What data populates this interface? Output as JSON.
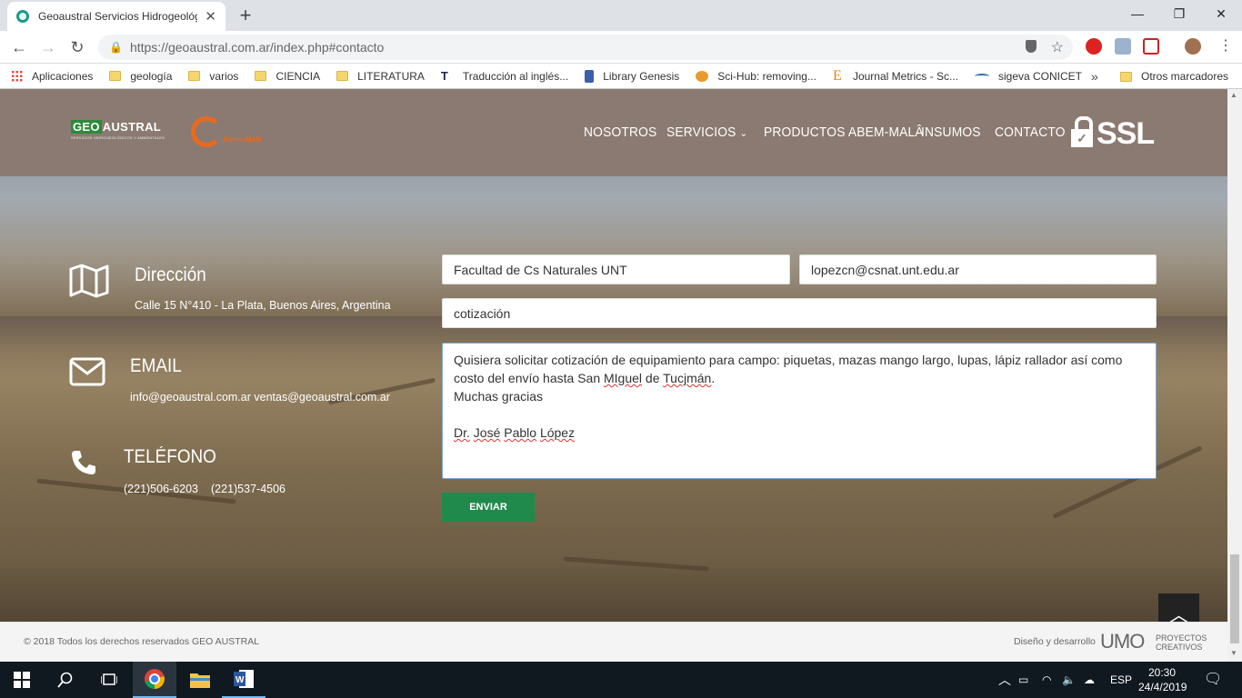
{
  "browser": {
    "tab_title": "Geoaustral Servicios Hidrogeológicos",
    "url": "https://geoaustral.com.ar/index.php#contacto",
    "bookmarks": [
      "Aplicaciones",
      "geología",
      "varios",
      "CIENCIA",
      "LITERATURA",
      "Traducción al inglés...",
      "Library Genesis",
      "Sci-Hub: removing...",
      "Journal Metrics - Sc...",
      "sigeva CONICET"
    ],
    "more": "»",
    "other_bookmarks": "Otros marcadores"
  },
  "header": {
    "logo_geo": "GEO",
    "logo_austral": "AUSTRAL",
    "logo_sub": "SERVICIOS HIDROGEOLÓGICOS Y AMBIENTALES",
    "logo2_tag": "Abem-Malâ",
    "nav": [
      "NOSOTROS",
      "SERVICIOS",
      "PRODUCTOS ABEM-MALÂ",
      "INSUMOS",
      "CONTACTO"
    ],
    "ssl": "SSL"
  },
  "contact": {
    "address_title": "Dirección",
    "address": "Calle 15 N°410 - La Plata, Buenos Aires, Argentina",
    "email_title": "EMAIL",
    "emails": "info@geoaustral.com.ar ventas@geoaustral.com.ar",
    "phone_title": "TELÉFONO",
    "phone1": "(221)506-6203",
    "phone2": "(221)537-4506"
  },
  "form": {
    "name_value": "Facultad de Cs Naturales UNT",
    "email_value": "lopezcn@csnat.unt.edu.ar",
    "subject_value": "cotización",
    "msg_line1": "Quisiera solicitar cotización de equipamiento para campo: piquetas, mazas mango largo, lupas, lápiz rallador así como",
    "msg_line2_a": "costo del envío hasta San ",
    "msg_line2_b": "MIguel",
    "msg_line2_c": " de ",
    "msg_line2_d": "Tucjmán",
    "msg_line2_e": ".",
    "msg_line3": "Muchas gracias",
    "msg_sig_a": "Dr.",
    "msg_sig_b": "José",
    "msg_sig_c": "Pablo",
    "msg_sig_d": "López",
    "send_label": "ENVIAR"
  },
  "footer": {
    "copyright": "© 2018 Todos los derechos reservados GEO AUSTRAL",
    "design": "Diseño y desarrollo",
    "umo": "UMO",
    "umo_sub": "PROYECTOS CREATIVOS"
  },
  "taskbar": {
    "lang": "ESP",
    "time": "20:30",
    "date": "24/4/2019"
  }
}
